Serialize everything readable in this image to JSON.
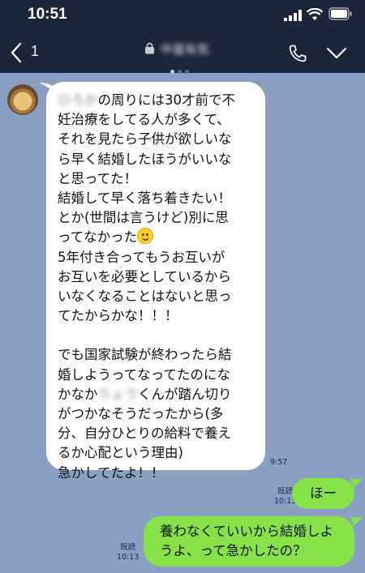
{
  "status_bar": {
    "time": "10:51"
  },
  "header": {
    "back_count": "1",
    "chat_title": "中富有気"
  },
  "received": {
    "lines": [
      [
        "",
        "ひろか",
        "の周りには30才前で不"
      ],
      [
        "妊治療をしてる人が多くて、"
      ],
      [
        "それを見たら子供が欲しいな"
      ],
      [
        "ら早く結婚したほうがいいな"
      ],
      [
        "と思ってた！"
      ],
      [
        "結婚して早く落ち着きたい！"
      ],
      [
        "とか(世間は言うけど)別に思"
      ],
      [
        "ってなかった"
      ],
      [
        "5年付き合ってもうお互いが"
      ],
      [
        "お互いを必要としているから"
      ],
      [
        "いなくなることはないと思っ"
      ],
      [
        "てたからかな！！！"
      ],
      [
        ""
      ],
      [
        "でも国家試験が終わったら結"
      ],
      [
        "婚しようってなってたのにな"
      ],
      [
        "かなか",
        "りょう",
        "くんが踏ん切り"
      ],
      [
        "がつかなそうだったから(多"
      ],
      [
        "分、自分ひとりの給料で養え"
      ],
      [
        "るか心配という理由)"
      ],
      [
        "急かしてたよ！！"
      ]
    ],
    "time": "9:57"
  },
  "sent": [
    {
      "text": "ほー",
      "read": "既読",
      "time": "10:13"
    },
    {
      "lines": [
        "養わなくていいから結婚しよ",
        "うよ、って急かしたの？"
      ],
      "read": "既読",
      "time": "10:13"
    }
  ],
  "colors": {
    "header": "#1d2539",
    "chat_bg": "#8aa0c3",
    "sent_bubble": "#85e249",
    "received_bubble": "#ffffff"
  },
  "icons": [
    "signal-icon",
    "wifi-icon",
    "battery-icon",
    "back-chevron-icon",
    "lock-icon",
    "phone-icon",
    "chevron-down-icon",
    "smile-emoji-icon"
  ]
}
